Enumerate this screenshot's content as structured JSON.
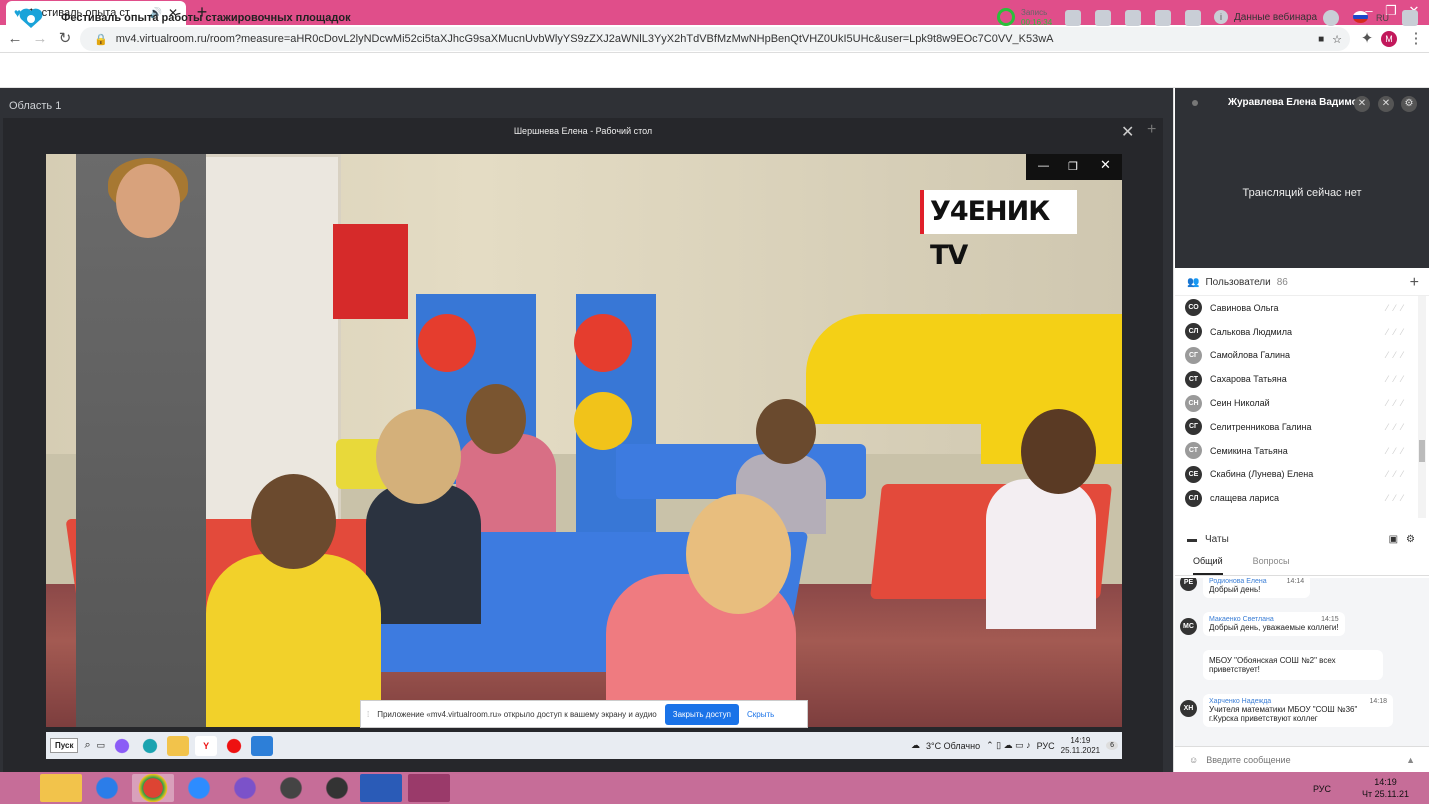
{
  "browser": {
    "tab_title": "Фестиваль опыта ст…",
    "url": "mv4.virtualroom.ru/room?measure=aHR0cDovL2lyNDcwMi52ci5taXJhcG9saXMucnUvbWlyYS9zZXJ2aWNlL3YyX2hTdVBfMzMwNHpBenQtVHZ0UkI5UHc&user=Lpk9t8w9EOc7C0VV_K53wA",
    "profile_letter": "M"
  },
  "app": {
    "title": "Фестиваль опыта работы стажировочных площадок",
    "record_label": "Запись",
    "record_time": "00:16:34",
    "webinar_data": "Данные вебинара",
    "lang": "RU"
  },
  "main": {
    "area_label": "Область 1",
    "window_title": "Шершнева Елена - Рабочий стол",
    "watermark": "У4ЕНИК TV",
    "share_notice": "Приложение «mv4.virtualroom.ru» открыло доступ к вашему экрану и аудио",
    "share_stop": "Закрыть доступ",
    "share_hide": "Скрыть"
  },
  "inner_taskbar": {
    "start": "Пуск",
    "weather": "3°C Облачно",
    "lang": "РУС",
    "time": "14:19",
    "date": "25.11.2021",
    "badge": "6"
  },
  "presenter": {
    "name": "Журавлева Елена Вадимо...",
    "no_broadcast": "Трансляций сейчас нет"
  },
  "users": {
    "title": "Пользователи",
    "count": "86",
    "list": [
      {
        "initials": "СО",
        "name": "Савинова Ольга"
      },
      {
        "initials": "СЛ",
        "name": "Салькова Людмила"
      },
      {
        "initials": "СГ",
        "name": "Самойлова Галина"
      },
      {
        "initials": "СТ",
        "name": "Сахарова Татьяна"
      },
      {
        "initials": "СН",
        "name": "Сеин Николай"
      },
      {
        "initials": "СГ",
        "name": "Селитренникова Галина"
      },
      {
        "initials": "СТ",
        "name": "Семикина Татьяна"
      },
      {
        "initials": "СЕ",
        "name": "Скабина (Лунева) Елена"
      },
      {
        "initials": "СЛ",
        "name": "слащева лариса"
      }
    ]
  },
  "chat": {
    "title": "Чаты",
    "tab_general": "Общий",
    "tab_questions": "Вопросы",
    "messages": [
      {
        "initials": "РЕ",
        "author": "Родионова Елена",
        "time": "14:14",
        "text": "Добрый день!"
      },
      {
        "initials": "МС",
        "author": "Макаенко Светлана",
        "time": "14:15",
        "text": "Добрый день, уважаемые коллеги!"
      },
      {
        "initials": "",
        "author": "",
        "time": "",
        "text": "МБОУ \"Обоянская СОШ №2\" всех приветствует!"
      },
      {
        "initials": "ХН",
        "author": "Харченко Надежда",
        "time": "14:18",
        "text": "Учителя математики МБОУ \"СОШ №36\" г.Курска приветствуют коллег"
      }
    ],
    "input_placeholder": "Введите сообщение"
  },
  "taskbar": {
    "lang": "РУС",
    "time": "14:19",
    "date": "Чт 25.11.21"
  }
}
